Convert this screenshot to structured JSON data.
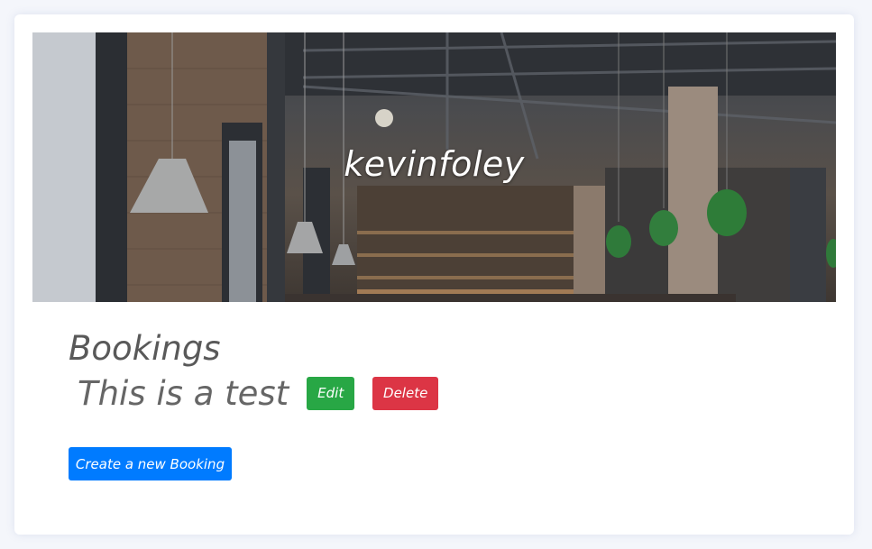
{
  "banner": {
    "username": "kevinfoley"
  },
  "bookings": {
    "heading": "Bookings",
    "items": [
      {
        "name": "This is a test",
        "edit_label": "Edit",
        "delete_label": "Delete"
      }
    ],
    "create_label": "Create a new Booking"
  },
  "colors": {
    "edit": "#28a745",
    "delete": "#dc3545",
    "primary": "#007bff",
    "heading": "#595959"
  },
  "icons": [
    "restaurant-interior-photo"
  ]
}
